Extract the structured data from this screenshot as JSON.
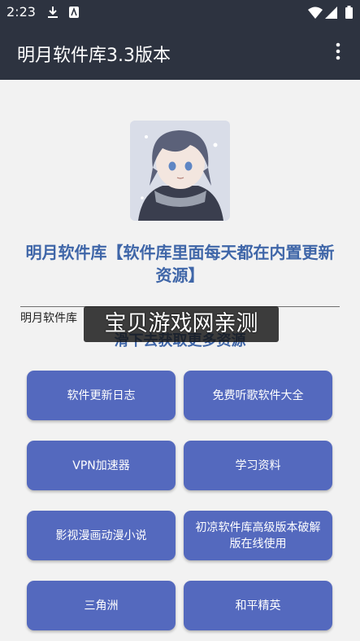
{
  "status": {
    "time": "2:23"
  },
  "appbar": {
    "title": "明月软件库3.3版本"
  },
  "main": {
    "headline": "明月软件库【软件库里面每天都在内置更新资源】",
    "hint": "明月软件库",
    "subhint": "滑下去获取更多资源",
    "watermark": "宝贝游戏网亲测"
  },
  "buttons": [
    {
      "label": "软件更新日志"
    },
    {
      "label": "免费听歌软件大全"
    },
    {
      "label": "VPN加速器"
    },
    {
      "label": "学习资料"
    },
    {
      "label": "影视漫画动漫小说"
    },
    {
      "label": "初凉软件库高级版本破解版在线使用"
    },
    {
      "label": "三角洲"
    },
    {
      "label": "和平精英"
    }
  ],
  "colors": {
    "appbar": "#2d3340",
    "accent_text": "#3f66a8",
    "button": "#5469be"
  }
}
